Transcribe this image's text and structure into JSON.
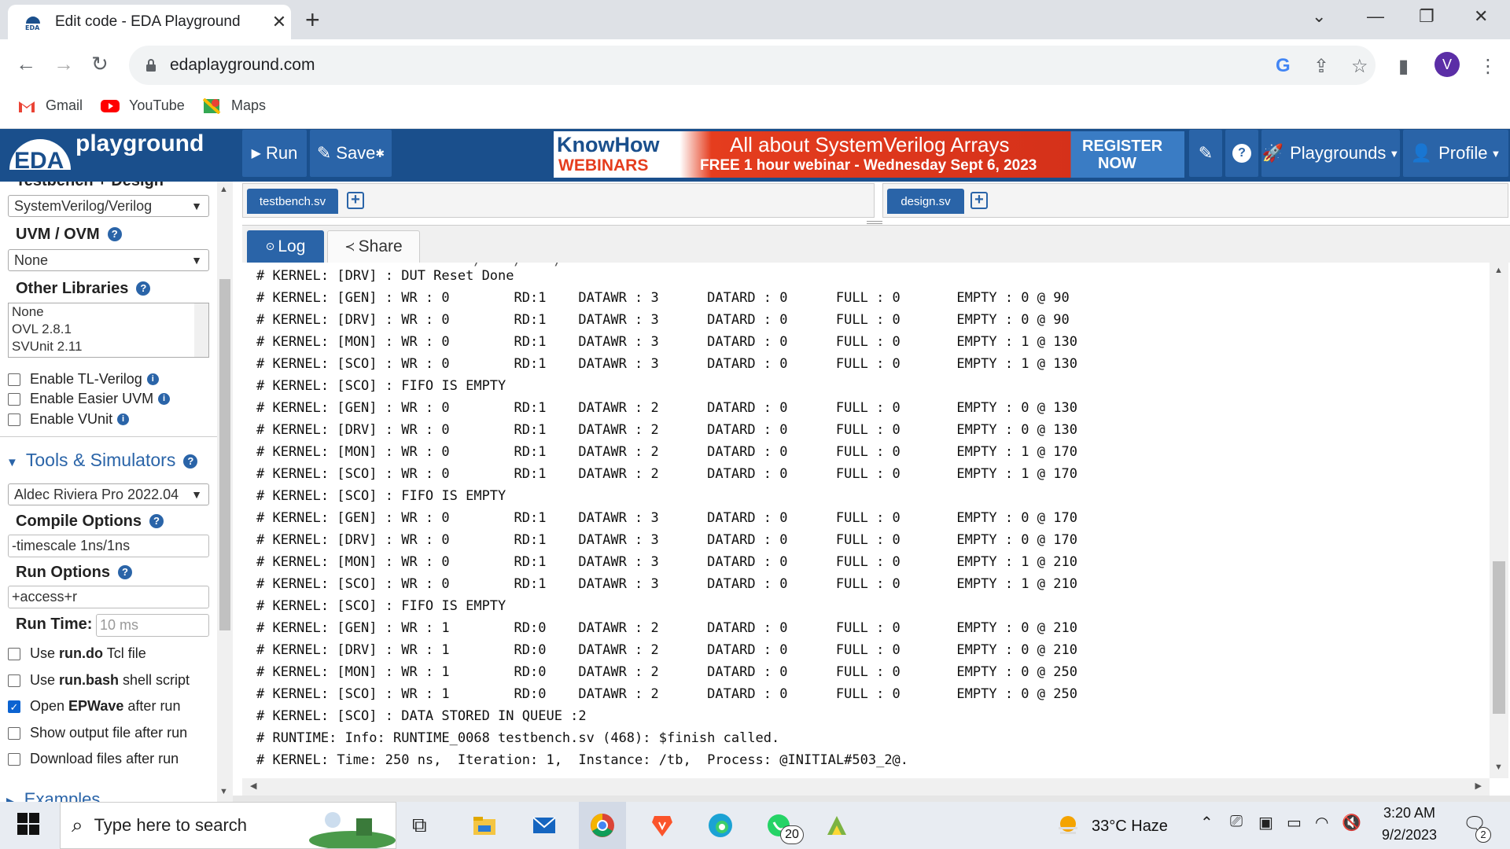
{
  "browser": {
    "tab_title": "Edit code - EDA Playground",
    "new_tab": "+",
    "close": "✕",
    "url": "edaplayground.com",
    "profile_initial": "V",
    "bookmarks": [
      {
        "label": "Gmail"
      },
      {
        "label": "YouTube"
      },
      {
        "label": "Maps"
      }
    ]
  },
  "header": {
    "logo_eda": "EDA",
    "logo_text": "playground",
    "run_label": "Run",
    "save_label": "Save",
    "playgrounds_label": "Playgrounds",
    "profile_label": "Profile",
    "banner": {
      "brand_top": "KnowHow",
      "brand_bottom": "WEBINARS",
      "headline": "All about SystemVerilog Arrays",
      "subline": "FREE 1 hour webinar - Wednesday Sept 6, 2023",
      "cta_top": "REGISTER",
      "cta_bottom": "NOW"
    }
  },
  "sidebar": {
    "cut_heading": "Testbench + Design",
    "language": "SystemVerilog/Verilog",
    "uvm_label": "UVM / OVM",
    "uvm_value": "None",
    "other_libs_label": "Other Libraries",
    "libs": [
      "None",
      "OVL 2.8.1",
      "SVUnit 2.11"
    ],
    "checks1": [
      {
        "label": "Enable TL-Verilog",
        "checked": false
      },
      {
        "label": "Enable Easier UVM",
        "checked": false
      },
      {
        "label": "Enable VUnit",
        "checked": false
      }
    ],
    "tools_label": "Tools & Simulators",
    "simulator": "Aldec Riviera Pro 2022.04",
    "compile_label": "Compile Options",
    "compile_value": "-timescale 1ns/1ns",
    "run_opts_label": "Run Options",
    "run_opts_value": "+access+r",
    "run_time_label": "Run Time:",
    "run_time_placeholder": "10 ms",
    "checks2": [
      {
        "pre": "Use ",
        "bold": "run.do",
        "post": " Tcl file",
        "checked": false
      },
      {
        "pre": "Use ",
        "bold": "run.bash",
        "post": " shell script",
        "checked": false
      },
      {
        "pre": "Open ",
        "bold": "EPWave",
        "post": " after run",
        "checked": true
      },
      {
        "pre": "Show output file after run",
        "bold": "",
        "post": "",
        "checked": false
      },
      {
        "pre": "Download files after run",
        "bold": "",
        "post": "",
        "checked": false
      }
    ],
    "examples_label": "Examples"
  },
  "editor": {
    "left_tab": "testbench.sv",
    "right_tab": "design.sv"
  },
  "log_panel": {
    "log_tab": "Log",
    "share_tab": "Share",
    "lines": [
      "# KERNEL: [DRV] : DUT Reset Done",
      "# KERNEL: [GEN] : WR : 0        RD:1    DATAWR : 3      DATARD : 0      FULL : 0       EMPTY : 0 @ 90",
      "# KERNEL: [DRV] : WR : 0        RD:1    DATAWR : 3      DATARD : 0      FULL : 0       EMPTY : 0 @ 90",
      "# KERNEL: [MON] : WR : 0        RD:1    DATAWR : 3      DATARD : 0      FULL : 0       EMPTY : 1 @ 130",
      "# KERNEL: [SCO] : WR : 0        RD:1    DATAWR : 3      DATARD : 0      FULL : 0       EMPTY : 1 @ 130",
      "# KERNEL: [SCO] : FIFO IS EMPTY",
      "# KERNEL: [GEN] : WR : 0        RD:1    DATAWR : 2      DATARD : 0      FULL : 0       EMPTY : 0 @ 130",
      "# KERNEL: [DRV] : WR : 0        RD:1    DATAWR : 2      DATARD : 0      FULL : 0       EMPTY : 0 @ 130",
      "# KERNEL: [MON] : WR : 0        RD:1    DATAWR : 2      DATARD : 0      FULL : 0       EMPTY : 1 @ 170",
      "# KERNEL: [SCO] : WR : 0        RD:1    DATAWR : 2      DATARD : 0      FULL : 0       EMPTY : 1 @ 170",
      "# KERNEL: [SCO] : FIFO IS EMPTY",
      "# KERNEL: [GEN] : WR : 0        RD:1    DATAWR : 3      DATARD : 0      FULL : 0       EMPTY : 0 @ 170",
      "# KERNEL: [DRV] : WR : 0        RD:1    DATAWR : 3      DATARD : 0      FULL : 0       EMPTY : 0 @ 170",
      "# KERNEL: [MON] : WR : 0        RD:1    DATAWR : 3      DATARD : 0      FULL : 0       EMPTY : 1 @ 210",
      "# KERNEL: [SCO] : WR : 0        RD:1    DATAWR : 3      DATARD : 0      FULL : 0       EMPTY : 1 @ 210",
      "# KERNEL: [SCO] : FIFO IS EMPTY",
      "# KERNEL: [GEN] : WR : 1        RD:0    DATAWR : 2      DATARD : 0      FULL : 0       EMPTY : 0 @ 210",
      "# KERNEL: [DRV] : WR : 1        RD:0    DATAWR : 2      DATARD : 0      FULL : 0       EMPTY : 0 @ 210",
      "# KERNEL: [MON] : WR : 1        RD:0    DATAWR : 2      DATARD : 0      FULL : 0       EMPTY : 0 @ 250",
      "# KERNEL: [SCO] : WR : 1        RD:0    DATAWR : 2      DATARD : 0      FULL : 0       EMPTY : 0 @ 250",
      "# KERNEL: [SCO] : DATA STORED IN QUEUE :2",
      "# RUNTIME: Info: RUNTIME_0068 testbench.sv (468): $finish called.",
      "# KERNEL: Time: 250 ns,  Iteration: 1,  Instance: /tb,  Process: @INITIAL#503_2@."
    ]
  },
  "taskbar": {
    "search_placeholder": "Type here to search",
    "whatsapp_badge": "20",
    "weather": "33°C  Haze",
    "time": "3:20 AM",
    "date": "9/2/2023",
    "notif_count": "2"
  },
  "colors": {
    "header_blue": "#1a4f8c",
    "button_blue": "#2a64a8",
    "chrome_tabstrip": "#dee1e6"
  }
}
